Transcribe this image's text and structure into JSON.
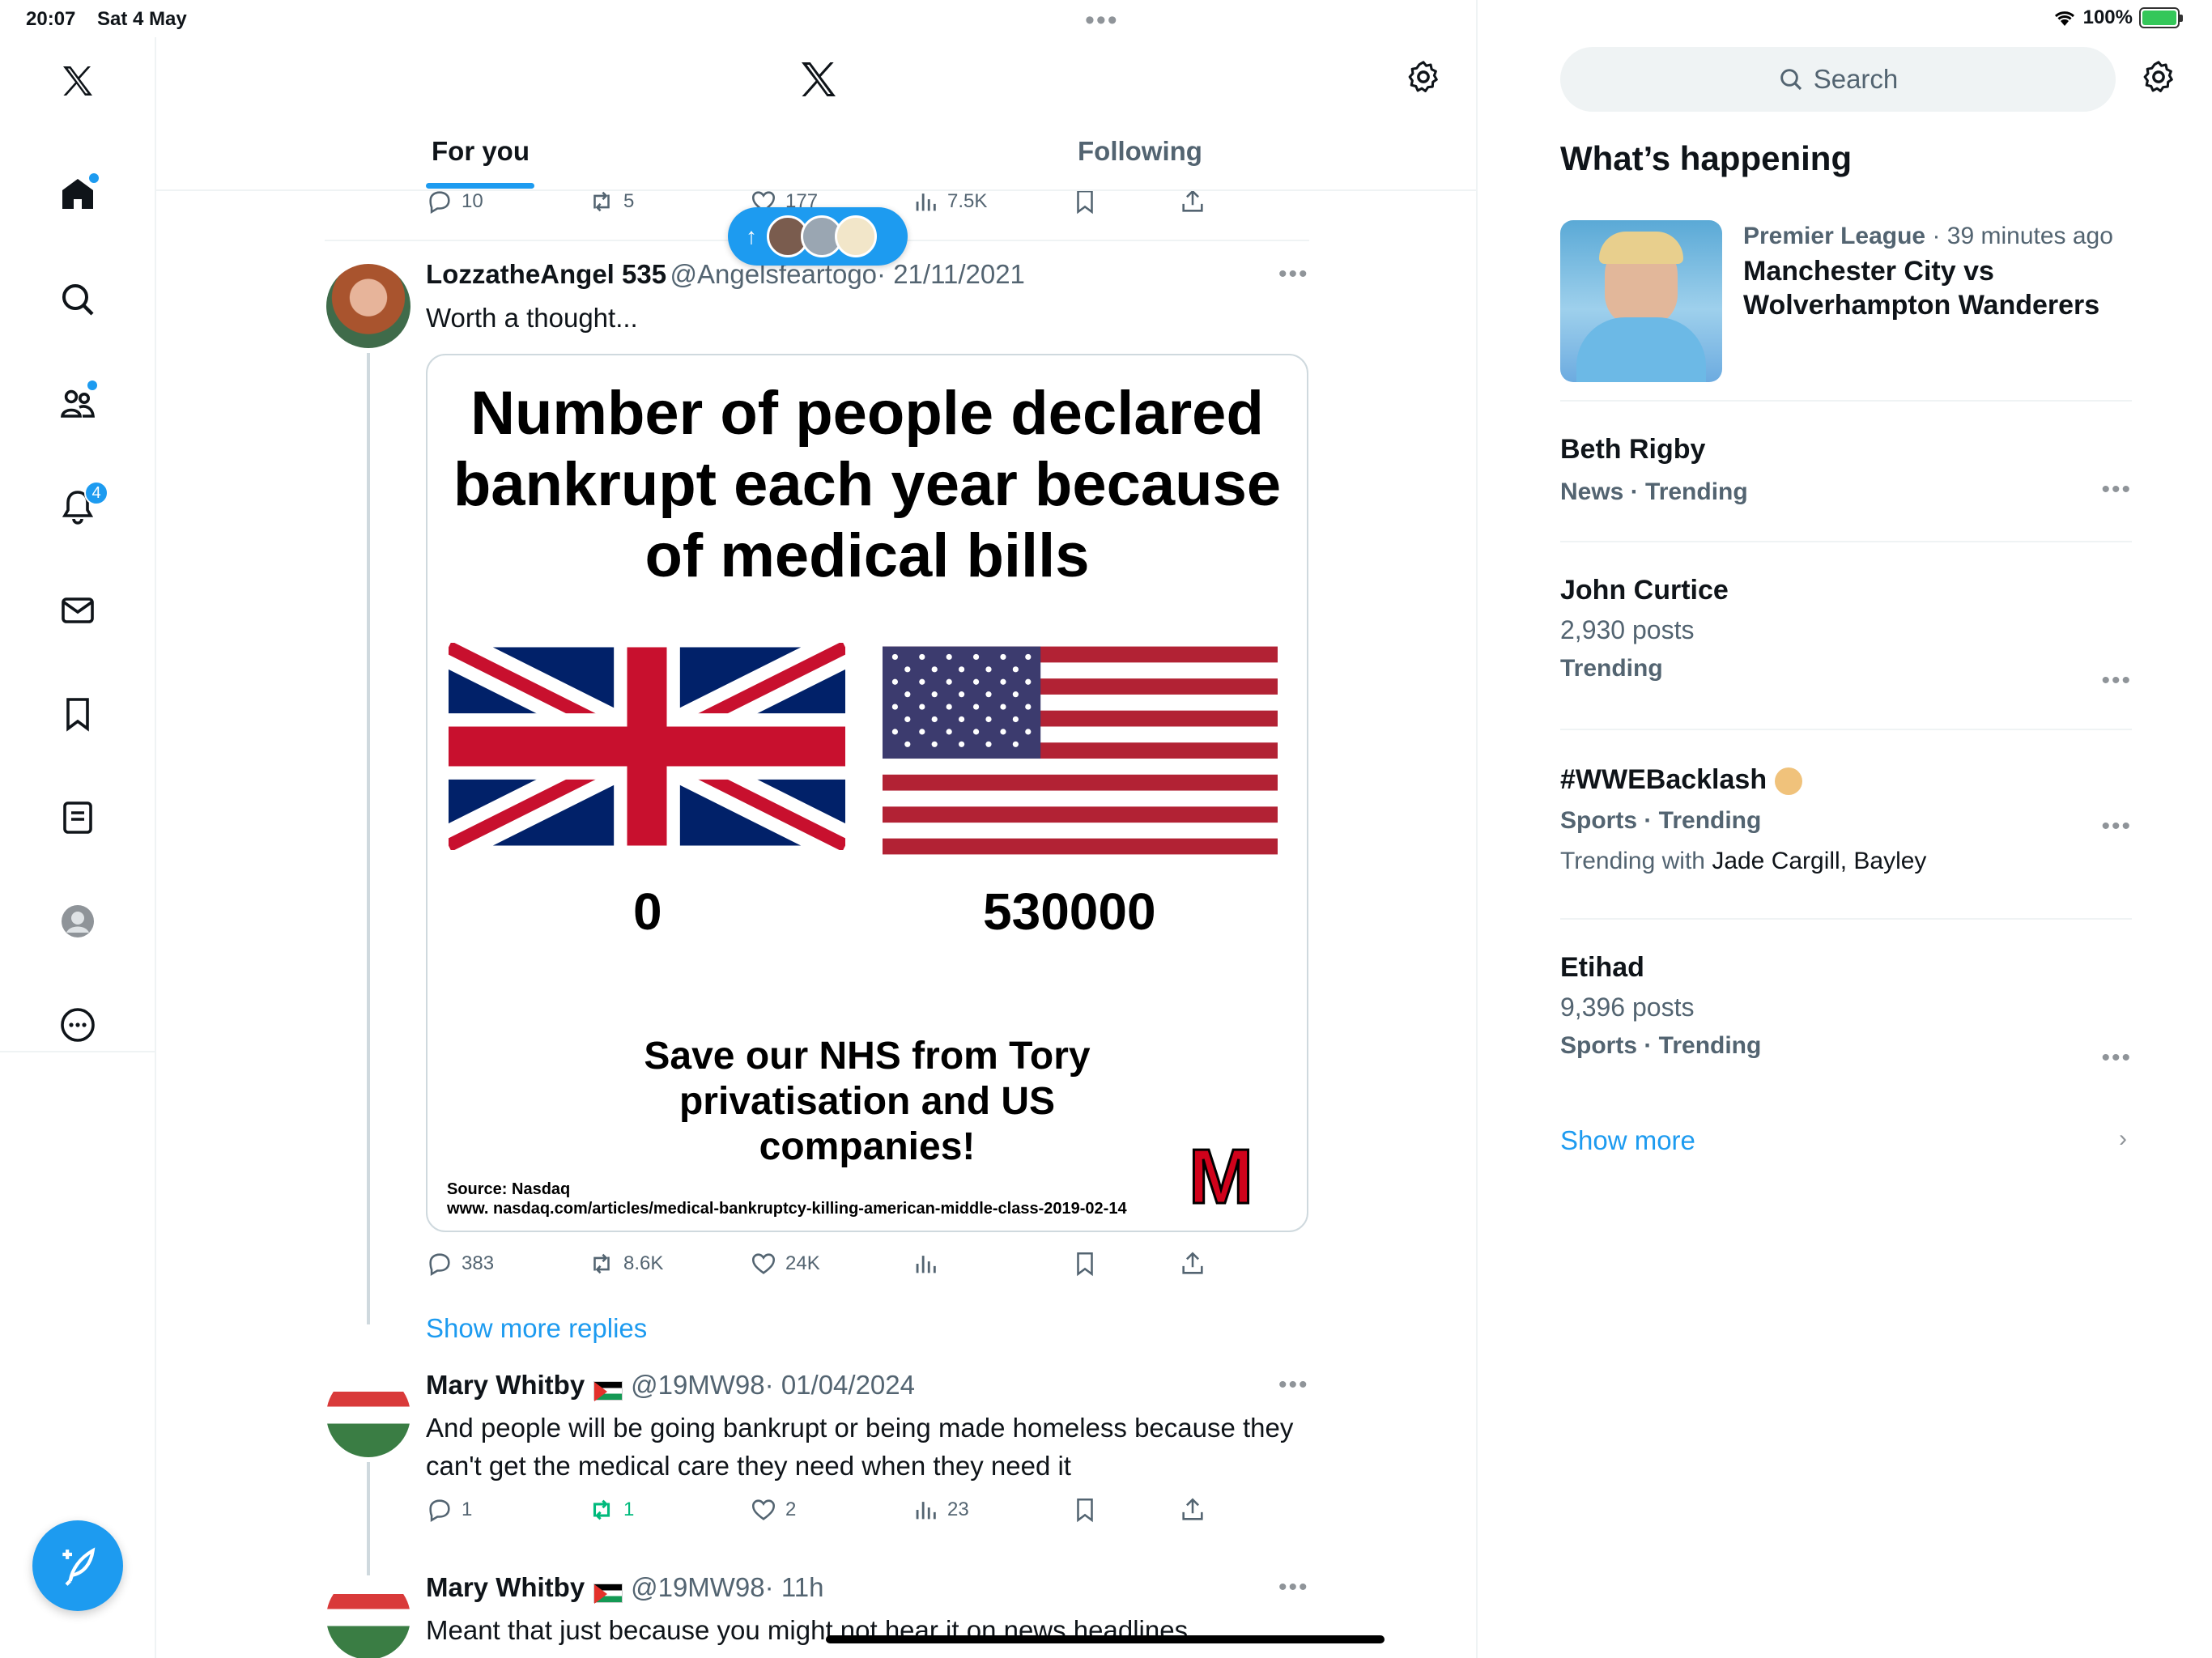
{
  "status": {
    "time": "20:07",
    "date": "Sat 4 May",
    "battery": "100%"
  },
  "nav": {
    "notifications_badge": "4"
  },
  "header": {
    "tabs": [
      {
        "label": "For you"
      },
      {
        "label": "Following"
      }
    ]
  },
  "prev_tweet": {
    "replies": "10",
    "reposts": "5",
    "likes": "177",
    "views": "7.5K"
  },
  "tweet1": {
    "name": "LozzatheAngel 535",
    "handle": "@Angelsfeartogo",
    "date": "· 21/11/2021",
    "text": "Worth a thought...",
    "media": {
      "headline": "Number of people declared bankrupt each year because of medical bills",
      "uk_value": "0",
      "us_value": "530000",
      "slogan": "Save our NHS from Tory privatisation and US companies!",
      "source_line1": "Source: Nasdaq",
      "source_line2": "www. nasdaq.com/articles/medical-bankruptcy-killing-american-middle-class-2019-02-14",
      "logo_letter": "M"
    },
    "replies": "383",
    "reposts": "8.6K",
    "likes": "24K"
  },
  "show_more_replies": "Show more replies",
  "tweet2": {
    "name": "Mary Whitby",
    "handle": "@19MW98",
    "date": "· 01/04/2024",
    "text": "And people will be going bankrupt or being made homeless because they can't get the medical care they need when they need it",
    "replies": "1",
    "reposts": "1",
    "likes": "2",
    "views": "23"
  },
  "tweet3": {
    "name": "Mary Whitby",
    "handle": "@19MW98",
    "date": "· 11h",
    "text": "Meant that just because you might not hear it on news headlines,"
  },
  "sidebar": {
    "search_placeholder": "Search",
    "heading": "What’s happening",
    "trends": [
      {
        "meta_category": "Premier League",
        "meta_time": " · 39 minutes ago",
        "title": "Manchester City vs Wolverhampton Wanderers"
      },
      {
        "title": "Beth Rigby",
        "meta": "News · Trending"
      },
      {
        "title": "John Curtice",
        "sub": "2,930 posts",
        "meta": "Trending"
      },
      {
        "title": "#WWEBacklash",
        "meta": "Sports · Trending",
        "with_prefix": "Trending with ",
        "with_names": "Jade Cargill, Bayley"
      },
      {
        "title": "Etihad",
        "sub": "9,396 posts",
        "meta": "Sports · Trending"
      }
    ],
    "show_more": "Show more"
  },
  "colors": {
    "accent": "#1d9bf0",
    "repost_green": "#00ba7c",
    "text": "#0f1419",
    "muted": "#536471"
  }
}
